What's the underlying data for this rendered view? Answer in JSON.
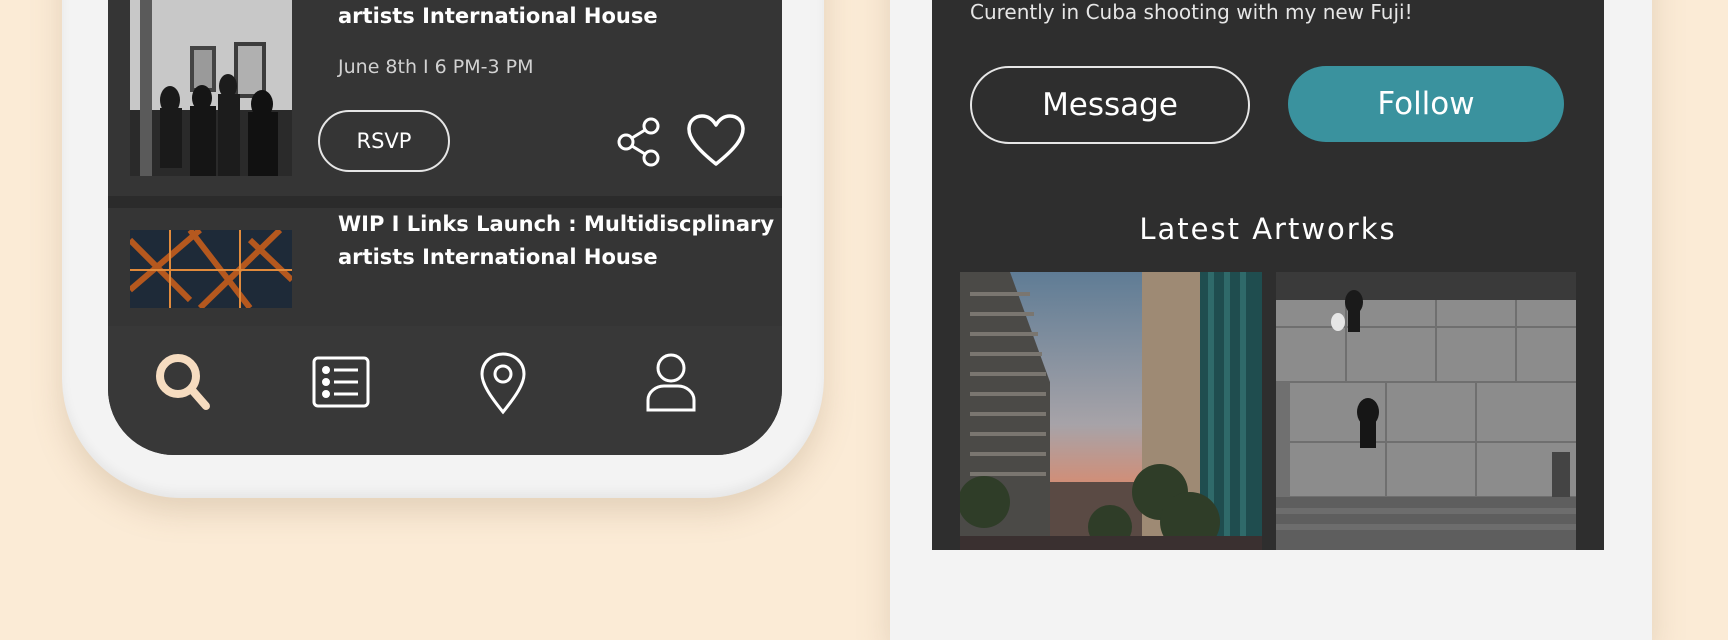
{
  "events": [
    {
      "title_lines": [
        "artists International House"
      ],
      "date": "June 8th I 6 PM-3 PM",
      "rsvp_label": "RSVP"
    },
    {
      "title_lines": [
        "WIP I Links Launch : Multidiscplinary",
        "artists International House"
      ]
    }
  ],
  "bottom_nav": {
    "items": [
      {
        "icon": "search-icon",
        "active": true
      },
      {
        "icon": "list-icon",
        "active": false
      },
      {
        "icon": "map-pin-icon",
        "active": false
      },
      {
        "icon": "user-icon",
        "active": false
      }
    ]
  },
  "profile": {
    "bio": "Curently in Cuba shooting with my new Fuji!",
    "message_label": "Message",
    "follow_label": "Follow",
    "latest_artworks_title": "Latest Artworks"
  },
  "colors": {
    "background": "#fbebd6",
    "screen": "#353535",
    "accent_teal": "#3a929e",
    "active_icon": "#f6dcc0"
  }
}
